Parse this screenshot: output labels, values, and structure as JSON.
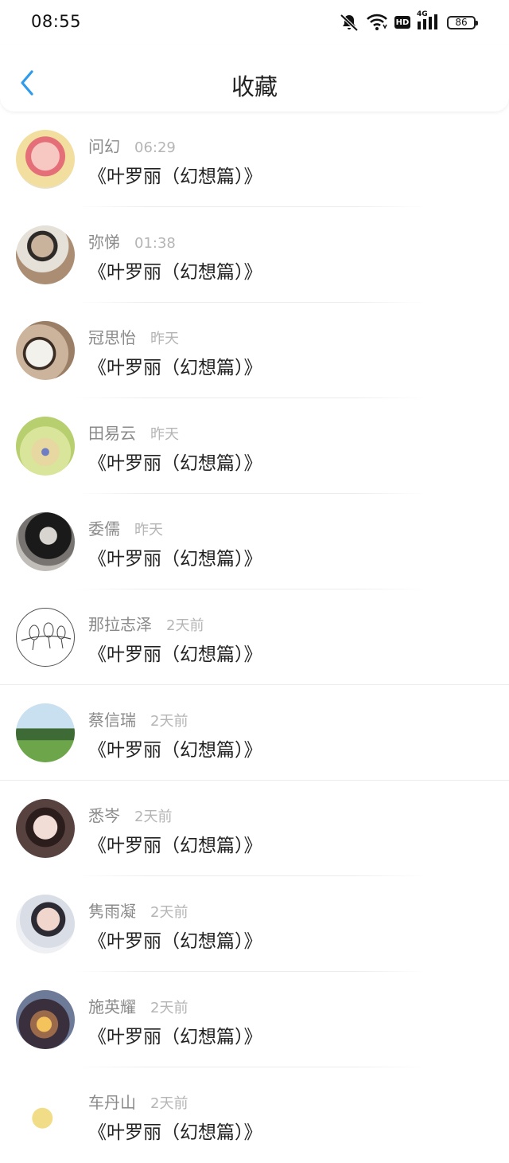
{
  "status_bar": {
    "time": "08:55",
    "battery": "86",
    "hd_label": "HD",
    "network": "4G",
    "icons": [
      "mute-icon",
      "wifi-icon",
      "hd-icon",
      "signal-icon",
      "battery-icon"
    ]
  },
  "header": {
    "title": "收藏",
    "back_icon": "chevron-left-icon"
  },
  "colors": {
    "accent": "#2f9bea",
    "name_text": "#8a8a8a",
    "time_text": "#b5b5b5",
    "content_text": "#222222"
  },
  "favorites": [
    {
      "name": "问幻",
      "time": "06:29",
      "content": "《叶罗丽（幻想篇）》"
    },
    {
      "name": "弥悌",
      "time": "01:38",
      "content": "《叶罗丽（幻想篇）》"
    },
    {
      "name": "冠思怡",
      "time": "昨天",
      "content": "《叶罗丽（幻想篇）》"
    },
    {
      "name": "田易云",
      "time": "昨天",
      "content": "《叶罗丽（幻想篇）》"
    },
    {
      "name": "委儒",
      "time": "昨天",
      "content": "《叶罗丽（幻想篇）》"
    },
    {
      "name": "那拉志泽",
      "time": "2天前",
      "content": "《叶罗丽（幻想篇）》"
    },
    {
      "name": "蔡信瑞",
      "time": "2天前",
      "content": "《叶罗丽（幻想篇）》"
    },
    {
      "name": "悉岑",
      "time": "2天前",
      "content": "《叶罗丽（幻想篇）》"
    },
    {
      "name": "隽雨凝",
      "time": "2天前",
      "content": "《叶罗丽（幻想篇）》"
    },
    {
      "name": "施英耀",
      "time": "2天前",
      "content": "《叶罗丽（幻想篇）》"
    },
    {
      "name": "车丹山",
      "time": "2天前",
      "content": "《叶罗丽（幻想篇）》"
    }
  ]
}
